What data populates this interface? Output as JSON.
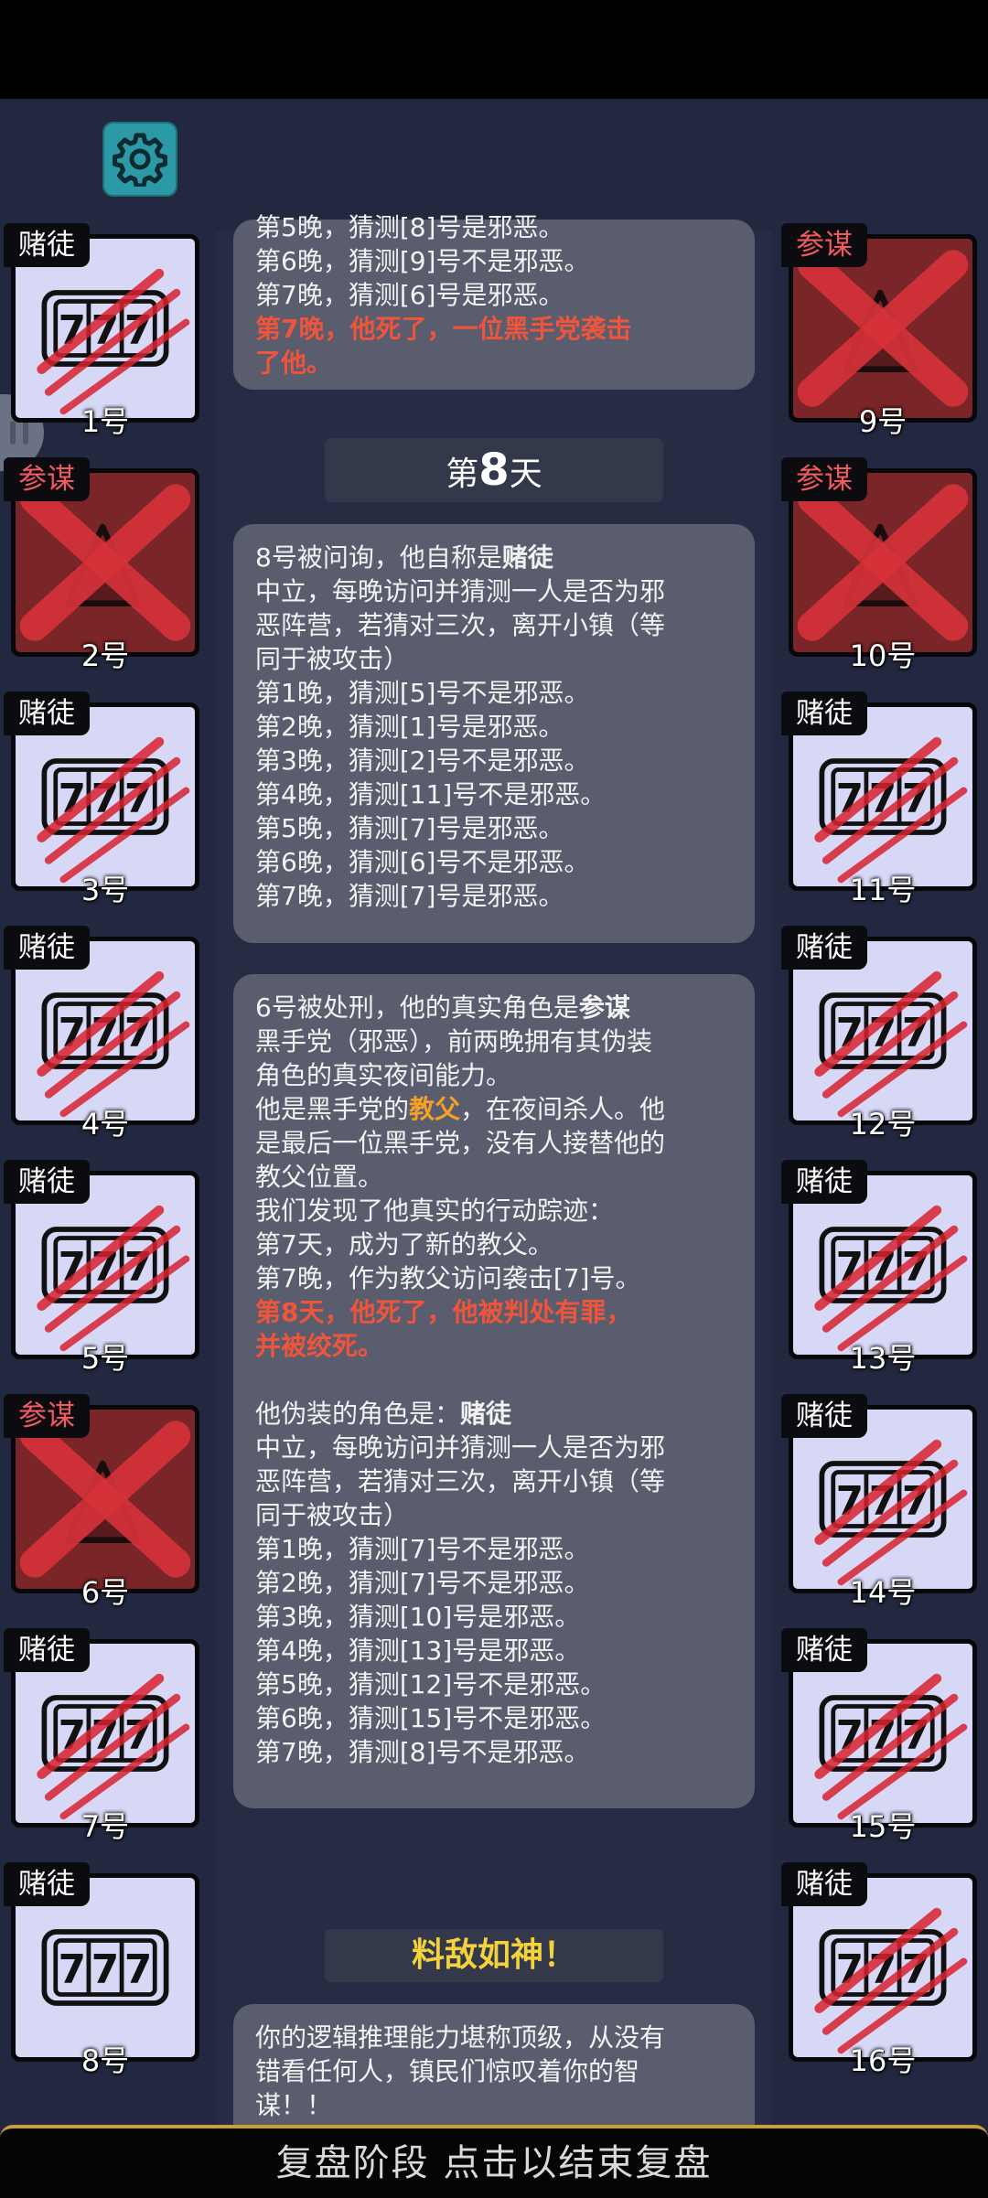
{
  "cards_left": [
    {
      "role": "赌徒",
      "label": "1号",
      "type": "gambler"
    },
    {
      "role": "参谋",
      "label": "2号",
      "type": "evil"
    },
    {
      "role": "赌徒",
      "label": "3号",
      "type": "gambler"
    },
    {
      "role": "赌徒",
      "label": "4号",
      "type": "gambler"
    },
    {
      "role": "赌徒",
      "label": "5号",
      "type": "gambler"
    },
    {
      "role": "参谋",
      "label": "6号",
      "type": "evil"
    },
    {
      "role": "赌徒",
      "label": "7号",
      "type": "gambler"
    },
    {
      "role": "赌徒",
      "label": "8号",
      "type": "gambler-alive"
    }
  ],
  "cards_right": [
    {
      "role": "参谋",
      "label": "9号",
      "type": "evil"
    },
    {
      "role": "参谋",
      "label": "10号",
      "type": "evil"
    },
    {
      "role": "赌徒",
      "label": "11号",
      "type": "gambler"
    },
    {
      "role": "赌徒",
      "label": "12号",
      "type": "gambler"
    },
    {
      "role": "赌徒",
      "label": "13号",
      "type": "gambler"
    },
    {
      "role": "赌徒",
      "label": "14号",
      "type": "gambler"
    },
    {
      "role": "赌徒",
      "label": "15号",
      "type": "gambler"
    },
    {
      "role": "赌徒",
      "label": "16号",
      "type": "gambler"
    }
  ],
  "log": {
    "box1": {
      "l1": "第5晚，猜测[8]号是邪恶。",
      "l2": "第6晚，猜测[9]号不是邪恶。",
      "l3": "第7晚，猜测[6]号是邪恶。",
      "l4": "第7晚，他死了，一位黑手党袭击",
      "l5": "了他。"
    },
    "day_prefix": "第",
    "day_number": "8",
    "day_suffix": "天",
    "box2": {
      "l1a": "8号被问询，他自称是",
      "l1b": "赌徒",
      "l2": "中立，每晚访问并猜测一人是否为邪",
      "l3": "恶阵营，若猜对三次，离开小镇（等",
      "l4": "同于被攻击）",
      "l5": "第1晚，猜测[5]号不是邪恶。",
      "l6": "第2晚，猜测[1]号是邪恶。",
      "l7": "第3晚，猜测[2]号不是邪恶。",
      "l8": "第4晚，猜测[11]号不是邪恶。",
      "l9": "第5晚，猜测[7]号是邪恶。",
      "l10": "第6晚，猜测[6]号不是邪恶。",
      "l11": "第7晚，猜测[7]号是邪恶。"
    },
    "box3": {
      "l1a": "6号被处刑，他的真实角色是",
      "l1b": "参谋",
      "l2": "黑手党（邪恶），前两晚拥有其伪装",
      "l3": "角色的真实夜间能力。",
      "l4a": "他是黑手党的",
      "l4b": "教父",
      "l4c": "，在夜间杀人。他",
      "l5": "是最后一位黑手党，没有人接替他的",
      "l6": "教父位置。",
      "l7": "我们发现了他真实的行动踪迹：",
      "l8": "第7天，成为了新的教父。",
      "l9": "第7晚，作为教父访问袭击[7]号。",
      "l10": "第8天，他死了，他被判处有罪，",
      "l11": "并被绞死。",
      "l12a": "他伪装的角色是：",
      "l12b": "赌徒",
      "l13": "中立，每晚访问并猜测一人是否为邪",
      "l14": "恶阵营，若猜对三次，离开小镇（等",
      "l15": "同于被攻击）",
      "l16": "第1晚，猜测[7]号不是邪恶。",
      "l17": "第2晚，猜测[7]号不是邪恶。",
      "l18": "第3晚，猜测[10]号是邪恶。",
      "l19": "第4晚，猜测[13]号是邪恶。",
      "l20": "第5晚，猜测[12]号不是邪恶。",
      "l21": "第6晚，猜测[15]号不是邪恶。",
      "l22": "第7晚，猜测[8]号不是邪恶。"
    },
    "verdict_title": "料敌如神！",
    "box4": {
      "l1": "你的逻辑推理能力堪称顶级，从没有",
      "l2": "错看任何人，镇民们惊叹着你的智",
      "l3": "谋！！"
    }
  },
  "bottom_button": "复盘阶段 点击以结束复盘",
  "icons": {
    "settings": "gear-icon",
    "side": "side-handle-icon",
    "gambler": "slot-777-icon",
    "evil": "crossed-out-icon"
  },
  "colors": {
    "background": "#222840",
    "red_text": "#f0553b",
    "gold_text": "#f4d23b",
    "settings_button": "#2c9aa6"
  }
}
